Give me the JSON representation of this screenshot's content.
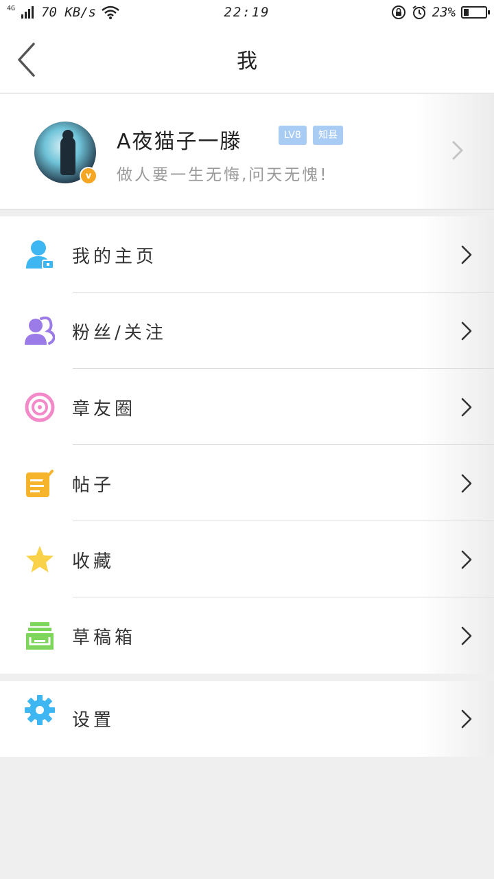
{
  "status_bar": {
    "network": "4G",
    "speed": "70 KB/s",
    "time": "22:19",
    "battery": "23%",
    "battery_level": 0.23
  },
  "header": {
    "title": "我"
  },
  "profile": {
    "name": "A夜猫子一滕",
    "level_tag": "LV8",
    "rank_tag": "知县",
    "signature": "做人要一生无悔,问天无愧!",
    "avatar_badge": "v"
  },
  "menu": [
    {
      "label": "我的主页",
      "icon": "profile-icon",
      "color": "#3db6f2"
    },
    {
      "label": "粉丝/关注",
      "icon": "fans-icon",
      "color": "#9b7be8"
    },
    {
      "label": "章友圈",
      "icon": "circle-icon",
      "color": "#f289c8"
    },
    {
      "label": "帖子",
      "icon": "post-icon",
      "color": "#f5b42a"
    },
    {
      "label": "收藏",
      "icon": "star-icon",
      "color": "#fad24a"
    },
    {
      "label": "草稿箱",
      "icon": "drafts-icon",
      "color": "#7ed65c"
    }
  ],
  "settings": {
    "label": "设置",
    "icon": "gear-icon",
    "color": "#3db6f2"
  }
}
